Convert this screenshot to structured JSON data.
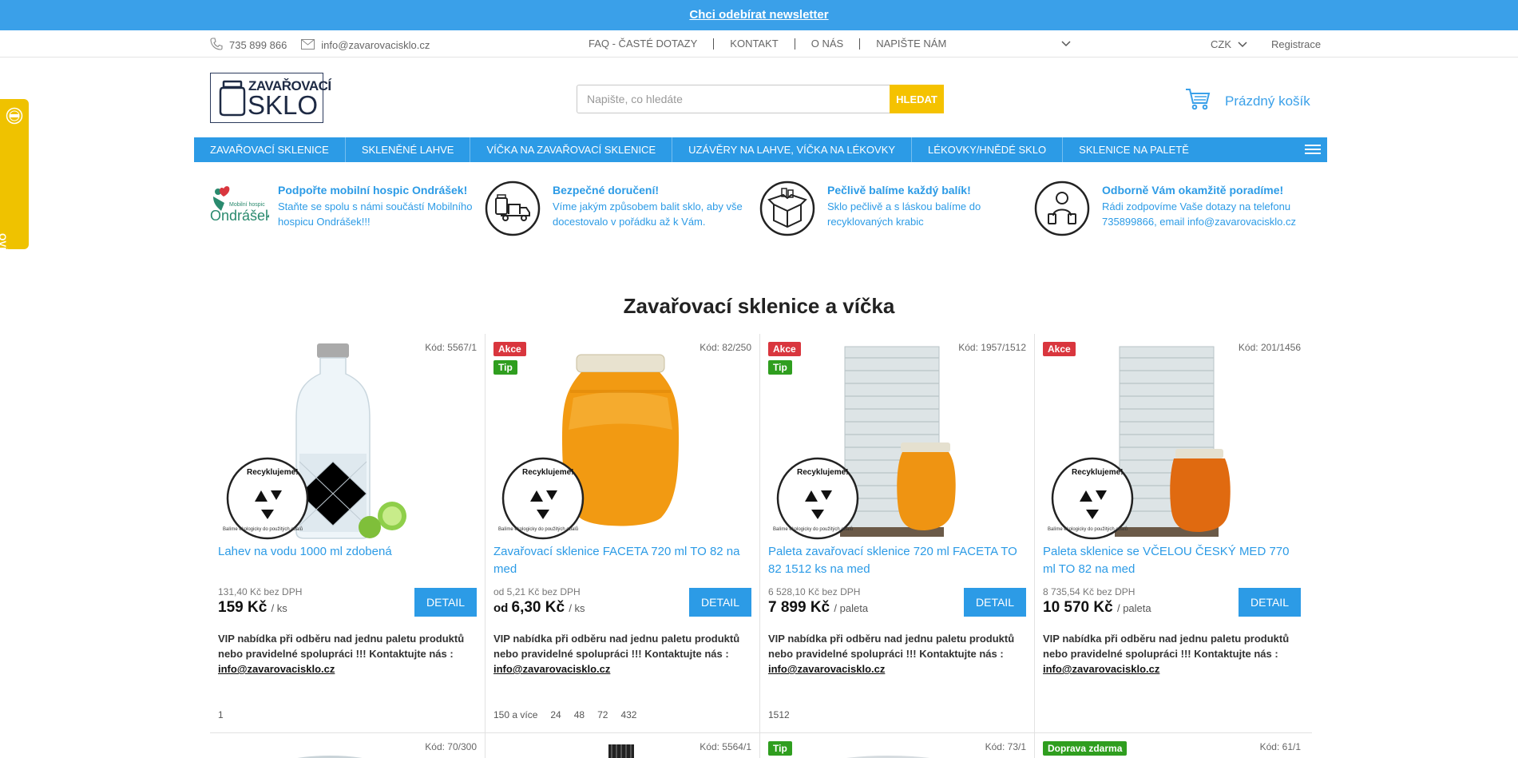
{
  "newsletter": {
    "link": "Chci odebírat newsletter"
  },
  "topbar": {
    "phone": "735 899 866",
    "email": "info@zavarovacisklo.cz",
    "links": [
      "FAQ - ČASTÉ DOTAZY",
      "KONTAKT",
      "O NÁS"
    ],
    "dropdown": "NAPIŠTE NÁM",
    "currency": "CZK",
    "register": "Registrace"
  },
  "header": {
    "logo_line1": "ZAVAŘOVACÍ",
    "logo_line2": "SKLO",
    "search_placeholder": "Napište, co hledáte",
    "search_button": "HLEDAT",
    "cart_label": "Prázdný košík"
  },
  "nav": {
    "items": [
      "ZAVAŘOVACÍ SKLENICE",
      "SKLENĚNÉ LAHVE",
      "VÍČKA NA ZAVAŘOVACÍ SKLENICE",
      "UZÁVĚRY NA LAHVE, VÍČKA NA LÉKOVKY",
      "LÉKOVKY/HNĚDÉ SKLO",
      "SKLENICE NA PALETĚ"
    ]
  },
  "side_badge": {
    "label": "OVĚŘENO ZÁKAZNÍKY"
  },
  "features": [
    {
      "title": "Podpořte mobilní hospic Ondrášek!",
      "desc": "Staňte se spolu s námi součástí Mobilního hospicu Ondrášek!!!",
      "logo_small": "Mobilní hospic",
      "logo_big": "Ondrášek"
    },
    {
      "title": "Bezpečné doručení!",
      "desc": "Víme jakým způsobem balit sklo, aby vše docestovalo v pořádku až k Vám."
    },
    {
      "title": "Pečlivě balíme každý balík!",
      "desc": "Sklo pečlivě a s láskou balíme do recyklovaných krabic"
    },
    {
      "title": "Odborně Vám okamžitě poradíme!",
      "desc": "Rádi zodpovíme Vaše dotazy na telefonu 735899866, email info@zavarovacisklo.cz"
    }
  ],
  "section": {
    "title": "Zavařovací sklenice a víčka"
  },
  "recycle_stamp": {
    "top": "Recyklujeme!",
    "bottom": "Balíme ekologicky do použitých obalů"
  },
  "products": [
    {
      "code": "Kód: 5567/1",
      "tags": [],
      "name": "Lahev na vodu 1000 ml zdobená",
      "no_vat": "131,40 Kč bez DPH",
      "from": "",
      "price": "159 Kč",
      "unit": "/ ks",
      "detail": "DETAIL",
      "vip": "VIP nabídka při odběru nad jednu paletu produktů nebo pravidelné spolupráci !!! Kontaktujte nás :",
      "vip_email": "info@zavarovacisklo.cz",
      "quantities": [
        "1"
      ]
    },
    {
      "code": "Kód: 82/250",
      "tags": [
        "Akce",
        "Tip"
      ],
      "name": "Zavařovací sklenice FACETA 720 ml TO 82 na med",
      "no_vat": "od 5,21 Kč bez DPH",
      "from": "od ",
      "price": "6,30 Kč",
      "unit": "/ ks",
      "detail": "DETAIL",
      "vip": "VIP nabídka při odběru nad jednu paletu produktů nebo pravidelné spolupráci !!! Kontaktujte nás :",
      "vip_email": "info@zavarovacisklo.cz",
      "quantities": [
        "150 a více",
        "24",
        "48",
        "72",
        "432"
      ]
    },
    {
      "code": "Kód: 1957/1512",
      "tags": [
        "Akce",
        "Tip"
      ],
      "name": "Paleta zavařovací sklenice 720 ml FACETA TO 82 1512 ks na med",
      "no_vat": "6 528,10 Kč bez DPH",
      "from": "",
      "price": "7 899 Kč",
      "unit": "/ paleta",
      "detail": "DETAIL",
      "vip": "VIP nabídka při odběru nad jednu paletu produktů nebo pravidelné spolupráci !!! Kontaktujte nás :",
      "vip_email": "info@zavarovacisklo.cz",
      "quantities": [
        "1512"
      ]
    },
    {
      "code": "Kód: 201/1456",
      "tags": [
        "Akce"
      ],
      "name": "Paleta sklenice se VČELOU ČESKÝ MED 770 ml TO 82 na med",
      "no_vat": "8 735,54 Kč bez DPH",
      "from": "",
      "price": "10 570 Kč",
      "unit": "/ paleta",
      "detail": "DETAIL",
      "vip": "VIP nabídka při odběru nad jednu paletu produktů nebo pravidelné spolupráci !!! Kontaktujte nás :",
      "vip_email": "info@zavarovacisklo.cz",
      "quantities": []
    }
  ],
  "products_row2": [
    {
      "code": "Kód: 70/300",
      "tags": []
    },
    {
      "code": "Kód: 5564/1",
      "tags": []
    },
    {
      "code": "Kód: 73/1",
      "tags": [
        "Tip"
      ]
    },
    {
      "code": "Kód: 61/1",
      "tags": [
        "Doprava zdarma"
      ]
    }
  ],
  "colors": {
    "brand_blue": "#2c9be6",
    "newsletter_blue": "#3aa0e9",
    "yellow": "#f5c200",
    "sale_red": "#d9363e",
    "tip_green": "#2f9e1f"
  }
}
